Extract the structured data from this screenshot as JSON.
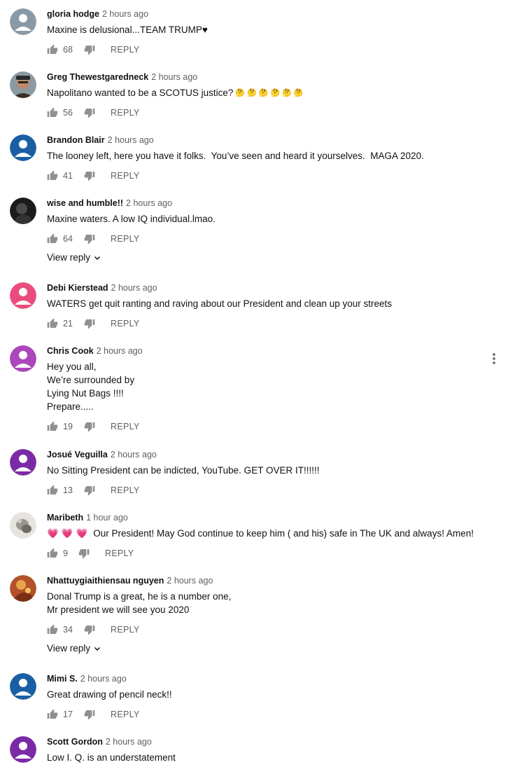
{
  "comments": [
    {
      "author": "gloria hodge",
      "time": "2 hours ago",
      "lines": [
        "Maxine is delusional...TEAM TRUMP♥"
      ],
      "likes": "68",
      "avatar_color": "#8a99a6"
    },
    {
      "author": "Greg Thewestgaredneck",
      "time": "2 hours ago",
      "lines": [
        "Napolitano wanted to be a SCOTUS justice?"
      ],
      "emojis": [
        "🤔",
        "🤔",
        "🤔",
        "🤔",
        "🤔",
        "🤔"
      ],
      "likes": "56",
      "avatar_color": "#5b4a3a"
    },
    {
      "author": "Brandon Blair",
      "time": "2 hours ago",
      "lines": [
        "The looney left, here you have it folks.  You’ve seen and heard it yourselves.  MAGA 2020."
      ],
      "likes": "41",
      "avatar_color": "#1a5fa3"
    },
    {
      "author": "wise and humble!!",
      "time": "2 hours ago",
      "lines": [
        "Maxine waters. A low IQ individual.lmao."
      ],
      "likes": "64",
      "avatar_color": "#1b1b1b",
      "view_reply": "View reply"
    },
    {
      "author": "Debi Kierstead",
      "time": "2 hours ago",
      "lines": [
        "WATERS get quit ranting and raving about our President and clean up your streets"
      ],
      "likes": "21",
      "avatar_color": "#ea4d7d"
    },
    {
      "author": "Chris Cook",
      "time": "2 hours ago",
      "lines": [
        "Hey you all,",
        "We’re surrounded by",
        "Lying Nut Bags !!!!",
        "Prepare....."
      ],
      "likes": "19",
      "avatar_color": "#ab47bc"
    },
    {
      "author": "Josué Veguilla",
      "time": "2 hours ago",
      "lines": [
        "No Sitting President can be indicted, YouTube. GET OVER IT!!!!!!"
      ],
      "likes": "13",
      "avatar_color": "#7b2aa6"
    },
    {
      "author": "Maribeth",
      "time": "1 hour ago",
      "lines": [
        " Our President! May God continue to keep him ( and his) safe in The UK and always! Amen!"
      ],
      "emojis_before": [
        "💗",
        "💗",
        "💗"
      ],
      "likes": "9",
      "avatar_color": "#c9c4bc"
    },
    {
      "author": "Nhattuygiaithiensau nguyen",
      "time": "2 hours ago",
      "lines": [
        "Donal Trump is a great, he is a number one,",
        "Mr president we will see you 2020"
      ],
      "likes": "34",
      "avatar_color": "#b2512a",
      "view_reply": "View reply"
    },
    {
      "author": "Mimi S.",
      "time": "2 hours ago",
      "lines": [
        "Great drawing of pencil neck!!"
      ],
      "likes": "17",
      "avatar_color": "#1a5fa3"
    },
    {
      "author": "Scott Gordon",
      "time": "2 hours ago",
      "lines": [
        "Low I. Q. is an understatement"
      ],
      "avatar_color": "#7b2aa6"
    }
  ],
  "reply_label": "REPLY",
  "icons": {
    "like": "thumbs-up-icon",
    "dislike": "thumbs-down-icon",
    "more": "kebab-menu-icon",
    "expand": "chevron-down-icon"
  }
}
